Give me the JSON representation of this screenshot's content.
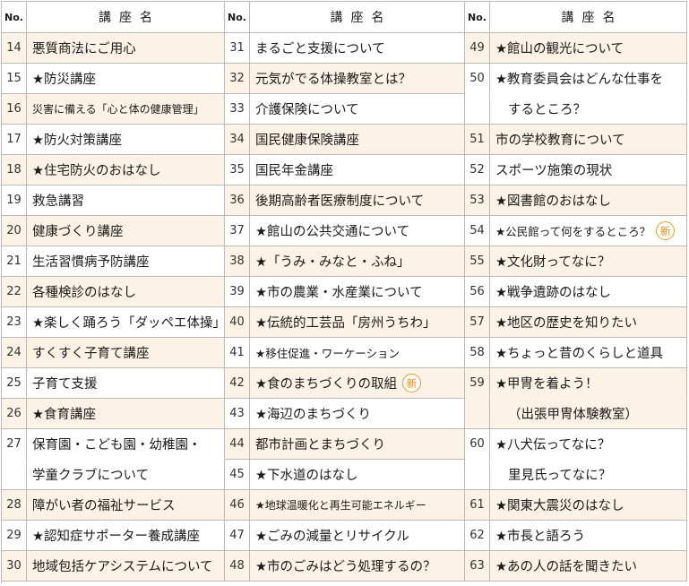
{
  "header": {
    "no": "No.",
    "name": "講座名"
  },
  "badge_label": "新",
  "columns": [
    {
      "rows": [
        {
          "no": "14",
          "name": "悪質商法にご用心",
          "shade": true
        },
        {
          "no": "15",
          "name": "★防災講座",
          "shade": false
        },
        {
          "no": "16",
          "name": "災害に備える「心と体の健康管理」",
          "shade": true,
          "size": "xs"
        },
        {
          "no": "17",
          "name": "★防火対策講座",
          "shade": false
        },
        {
          "no": "18",
          "name": "★住宅防火のおはなし",
          "shade": true
        },
        {
          "no": "19",
          "name": "救急講習",
          "shade": false
        },
        {
          "no": "20",
          "name": "健康づくり講座",
          "shade": true
        },
        {
          "no": "21",
          "name": "生活習慣病予防講座",
          "shade": false
        },
        {
          "no": "22",
          "name": "各種検診のはなし",
          "shade": true
        },
        {
          "no": "23",
          "name": "★楽しく踊ろう「ダッペエ体操」",
          "shade": false
        },
        {
          "no": "24",
          "name": "すくすく子育て講座",
          "shade": true
        },
        {
          "no": "25",
          "name": "子育て支援",
          "shade": false
        },
        {
          "no": "26",
          "name": "★食育講座",
          "shade": true
        },
        {
          "no": "27",
          "name": "保育園・こども園・幼稚園・",
          "shade": false,
          "open": true
        },
        {
          "no": "",
          "name": "学童クラブについて",
          "shade": false
        },
        {
          "no": "28",
          "name": "障がい者の福祉サービス",
          "shade": true
        },
        {
          "no": "29",
          "name": "★認知症サポーター養成講座",
          "shade": false
        },
        {
          "no": "30",
          "name": "地域包括ケアシステムについて",
          "shade": true
        }
      ]
    },
    {
      "rows": [
        {
          "no": "31",
          "name": "まるごと支援について",
          "shade": false
        },
        {
          "no": "32",
          "name": "元気がでる体操教室とは？",
          "shade": true
        },
        {
          "no": "33",
          "name": "介護保険について",
          "shade": false
        },
        {
          "no": "34",
          "name": "国民健康保険講座",
          "shade": true
        },
        {
          "no": "35",
          "name": "国民年金講座",
          "shade": false
        },
        {
          "no": "36",
          "name": "後期高齢者医療制度について",
          "shade": true
        },
        {
          "no": "37",
          "name": "★館山の公共交通について",
          "shade": false
        },
        {
          "no": "38",
          "name": "★「うみ・みなと・ふね」",
          "shade": true
        },
        {
          "no": "39",
          "name": "★市の農業・水産業について",
          "shade": false
        },
        {
          "no": "40",
          "name": "★伝統的工芸品「房州うちわ」",
          "shade": true
        },
        {
          "no": "41",
          "name": "★移住促進・ワーケーション",
          "shade": false,
          "size": "sm"
        },
        {
          "no": "42",
          "name": "★食のまちづくりの取組",
          "shade": true,
          "badge": true
        },
        {
          "no": "43",
          "name": "★海辺のまちづくり",
          "shade": false
        },
        {
          "no": "44",
          "name": "都市計画とまちづくり",
          "shade": true
        },
        {
          "no": "45",
          "name": "★下水道のはなし",
          "shade": false
        },
        {
          "no": "46",
          "name": "★地球温暖化と再生可能エネルギー",
          "shade": true,
          "size": "xs"
        },
        {
          "no": "47",
          "name": "★ごみの減量とリサイクル",
          "shade": false
        },
        {
          "no": "48",
          "name": "★市のごみはどう処理するの？",
          "shade": true
        }
      ]
    },
    {
      "rows": [
        {
          "no": "49",
          "name": "★館山の観光について",
          "shade": true
        },
        {
          "no": "50",
          "name": "★教育委員会はどんな仕事を",
          "shade": false,
          "open": true
        },
        {
          "no": "",
          "name": "するところ？",
          "shade": false,
          "indent": true
        },
        {
          "no": "51",
          "name": "市の学校教育について",
          "shade": true
        },
        {
          "no": "52",
          "name": "スポーツ施策の現状",
          "shade": false
        },
        {
          "no": "53",
          "name": "★図書館のおはなし",
          "shade": true
        },
        {
          "no": "54",
          "name": "★公民館って何をするところ？",
          "shade": false,
          "size": "sm",
          "badge": true
        },
        {
          "no": "55",
          "name": "★文化財ってなに？",
          "shade": true
        },
        {
          "no": "56",
          "name": "★戦争遺跡のはなし",
          "shade": false
        },
        {
          "no": "57",
          "name": "★地区の歴史を知りたい",
          "shade": true
        },
        {
          "no": "58",
          "name": "★ちょっと昔のくらしと道具",
          "shade": false
        },
        {
          "no": "59",
          "name": "★甲冑を着よう！",
          "shade": true,
          "open": true
        },
        {
          "no": "",
          "name": "（出張甲冑体験教室）",
          "shade": true,
          "indent": true
        },
        {
          "no": "60",
          "name": "★八犬伝ってなに？",
          "shade": false,
          "open": true
        },
        {
          "no": "",
          "name": "里見氏ってなに？",
          "shade": false,
          "indent": true
        },
        {
          "no": "61",
          "name": "★関東大震災のはなし",
          "shade": true
        },
        {
          "no": "62",
          "name": "★市長と語ろう",
          "shade": false
        },
        {
          "no": "63",
          "name": "★あの人の話を聞きたい",
          "shade": true
        }
      ]
    }
  ]
}
